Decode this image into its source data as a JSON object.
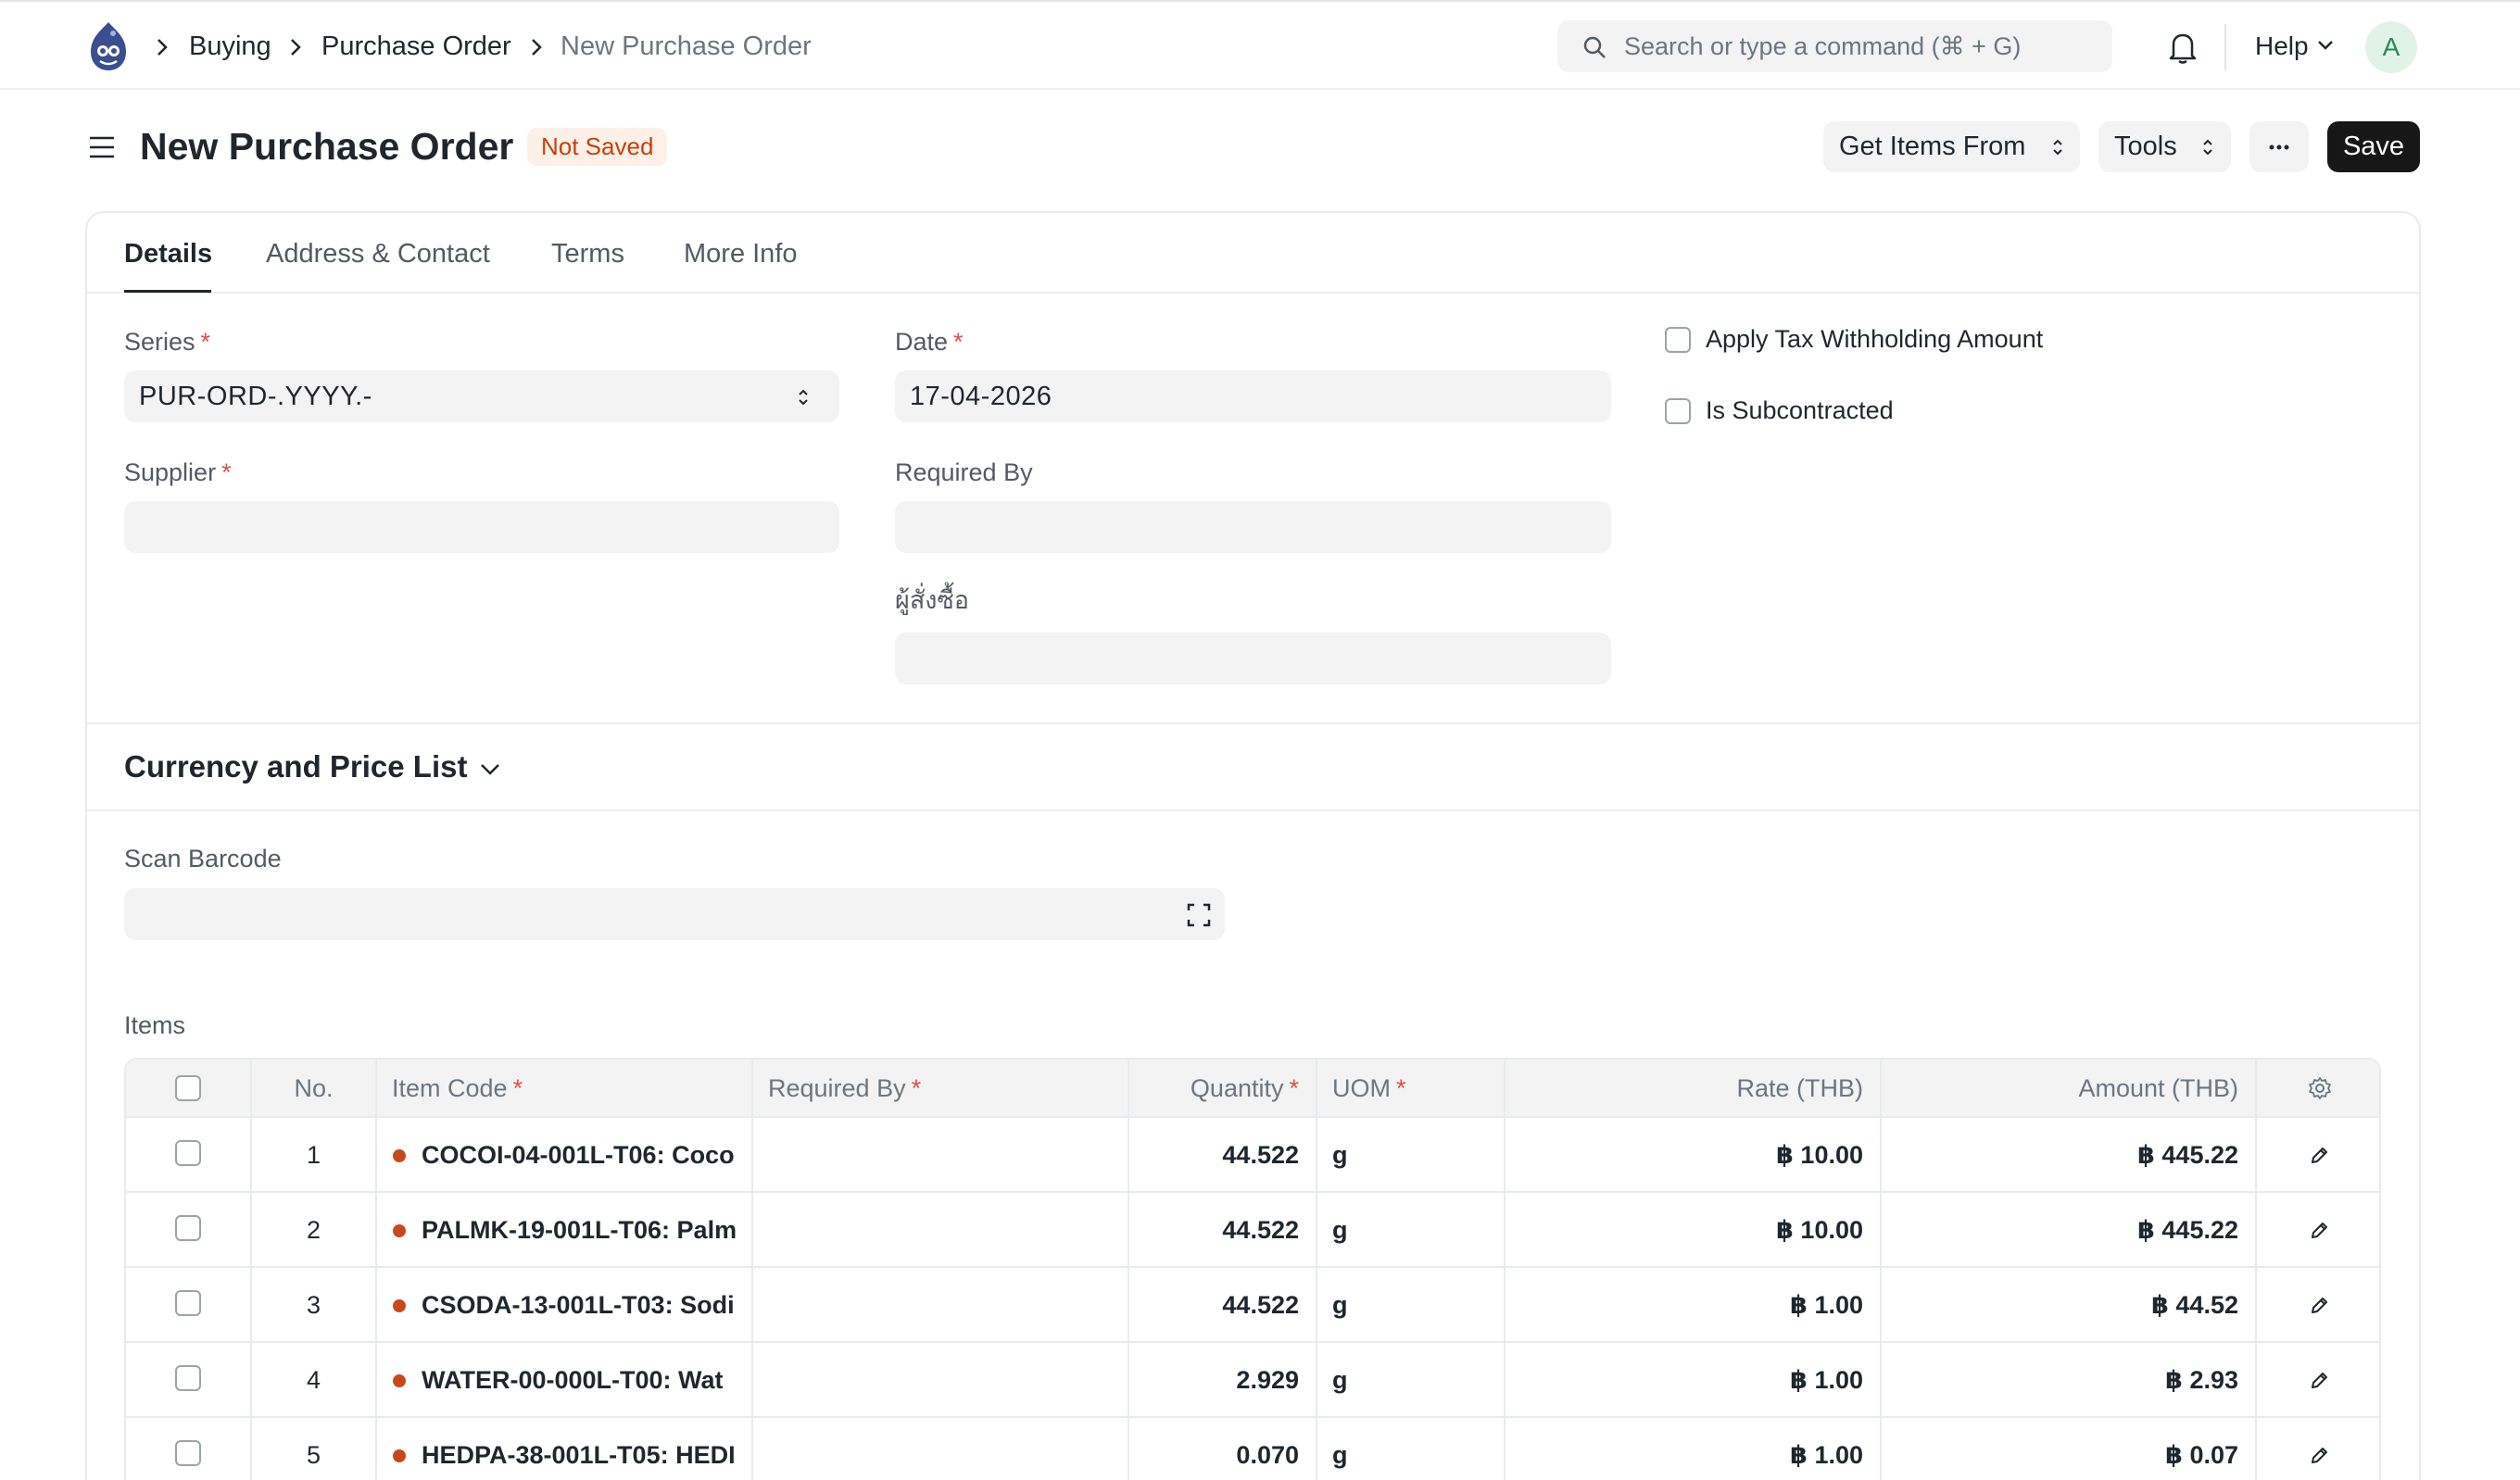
{
  "breadcrumbs": [
    "Buying",
    "Purchase Order",
    "New Purchase Order"
  ],
  "search": {
    "placeholder": "Search or type a command (⌘ + G)"
  },
  "navbar": {
    "help_label": "Help",
    "avatar_initial": "A"
  },
  "header": {
    "title": "New Purchase Order",
    "status_badge": "Not Saved",
    "get_items_label": "Get Items From",
    "tools_label": "Tools",
    "more_label": "···",
    "save_label": "Save"
  },
  "tabs": [
    {
      "label": "Details",
      "active": true
    },
    {
      "label": "Address & Contact",
      "active": false
    },
    {
      "label": "Terms",
      "active": false
    },
    {
      "label": "More Info",
      "active": false
    }
  ],
  "form": {
    "series": {
      "label": "Series",
      "required_mark": "*",
      "value": "PUR-ORD-.YYYY.-"
    },
    "date": {
      "label": "Date",
      "required_mark": "*",
      "value": "17-04-2026"
    },
    "supplier": {
      "label": "Supplier",
      "required_mark": "*",
      "value": ""
    },
    "required_by": {
      "label": "Required By",
      "value": ""
    },
    "orderer": {
      "label": "ผู้สั่งซื้อ",
      "value": ""
    },
    "apply_tax_withholding": {
      "label": "Apply Tax Withholding Amount",
      "checked": false
    },
    "is_subcontracted": {
      "label": "Is Subcontracted",
      "checked": false
    }
  },
  "currency_section": {
    "title": "Currency and Price List",
    "collapsed": true
  },
  "scan_barcode": {
    "label": "Scan Barcode",
    "value": ""
  },
  "items": {
    "label": "Items",
    "columns": {
      "no": "No.",
      "item_code": "Item Code",
      "required_by": "Required By",
      "quantity": "Quantity",
      "uom": "UOM",
      "rate": "Rate (THB)",
      "amount": "Amount (THB)",
      "required_mark": "*"
    },
    "rows": [
      {
        "no": "1",
        "item_code": "COCOI-04-001L-T06: Coco",
        "required_by": "",
        "quantity": "44.522",
        "uom": "g",
        "rate": "฿ 10.00",
        "amount": "฿ 445.22"
      },
      {
        "no": "2",
        "item_code": "PALMK-19-001L-T06: Palm",
        "required_by": "",
        "quantity": "44.522",
        "uom": "g",
        "rate": "฿ 10.00",
        "amount": "฿ 445.22"
      },
      {
        "no": "3",
        "item_code": "CSODA-13-001L-T03: Sodi",
        "required_by": "",
        "quantity": "44.522",
        "uom": "g",
        "rate": "฿ 1.00",
        "amount": "฿ 44.52"
      },
      {
        "no": "4",
        "item_code": "WATER-00-000L-T00: Wat",
        "required_by": "",
        "quantity": "2.929",
        "uom": "g",
        "rate": "฿ 1.00",
        "amount": "฿ 2.93"
      },
      {
        "no": "5",
        "item_code": "HEDPA-38-001L-T05: HEDI",
        "required_by": "",
        "quantity": "0.070",
        "uom": "g",
        "rate": "฿ 1.00",
        "amount": "฿ 0.07"
      }
    ]
  },
  "colors": {
    "accent_dark": "#171717",
    "badge_bg": "#fdf0e7",
    "badge_text": "#c4410f",
    "required": "#e24c4c",
    "item_dot": "#c9481b",
    "avatar_bg": "#dff4e6",
    "avatar_text": "#2d8659"
  },
  "icons": [
    "app-logo-icon",
    "chevron-right-icon",
    "search-icon",
    "bell-icon",
    "chevron-down-icon",
    "hamburger-icon",
    "updown-chevron-icon",
    "more-dots-icon",
    "scan-icon",
    "gear-icon",
    "pencil-icon"
  ]
}
